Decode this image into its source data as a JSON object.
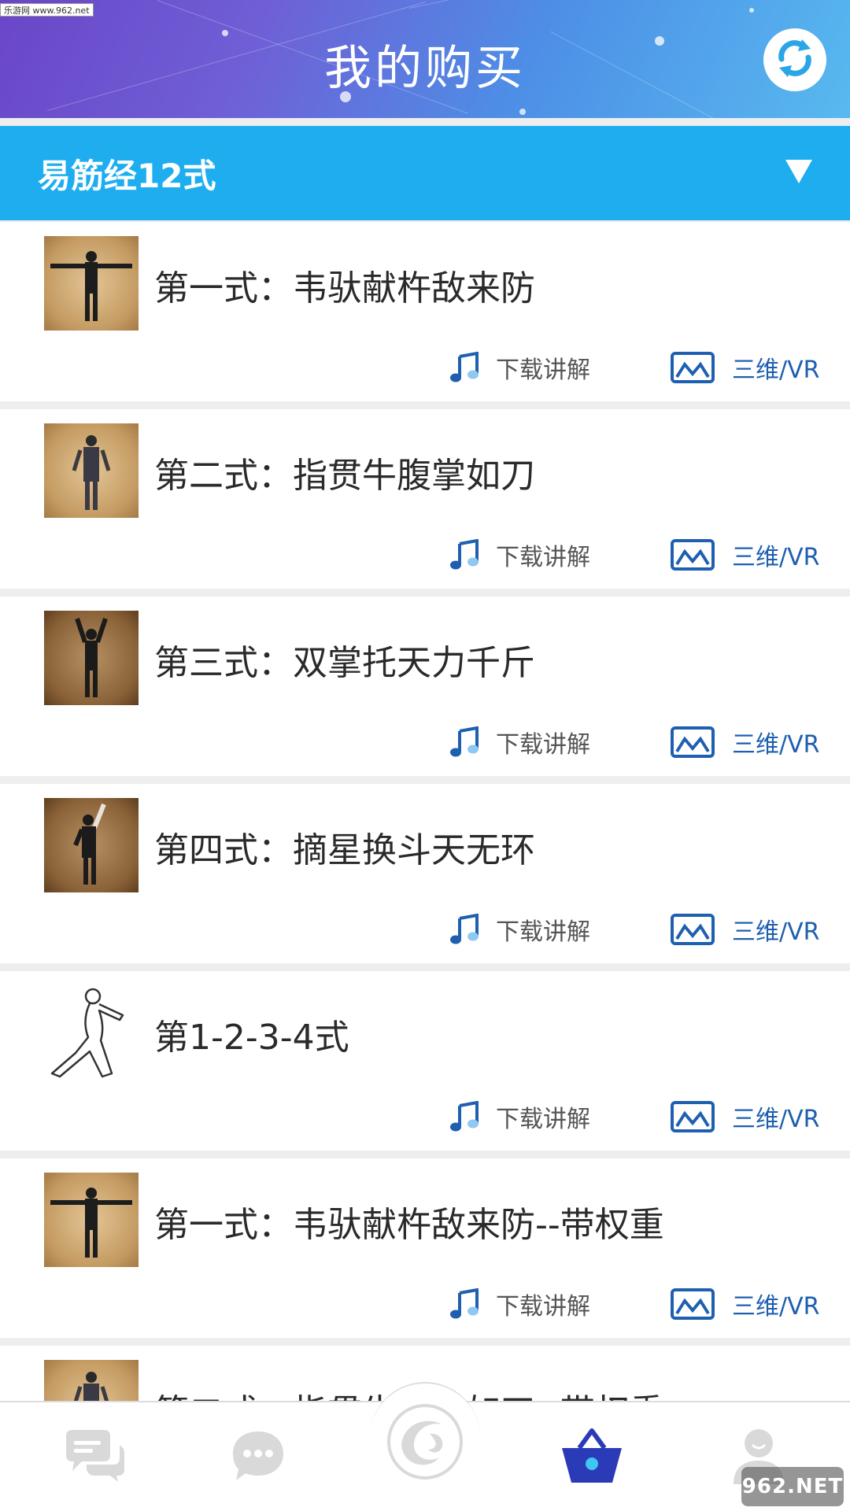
{
  "header": {
    "title": "我的购买",
    "refresh_icon": "refresh-icon"
  },
  "watermarks": {
    "top_left": "乐游网 www.962.net",
    "bottom_right": "962.NET"
  },
  "section": {
    "title": "易筋经12式",
    "toggle_icon": "triangle-down-icon"
  },
  "actions": {
    "audio_label": "下载讲解",
    "vr_label": "三维/VR"
  },
  "items": [
    {
      "title": "第一式：韦驮献杵敌来防",
      "thumb": "figure-arms-out"
    },
    {
      "title": "第二式：指贯牛腹掌如刀",
      "thumb": "figure-hands-down"
    },
    {
      "title": "第三式：双掌托天力千斤",
      "thumb": "figure-arms-up"
    },
    {
      "title": "第四式：摘星换斗天无环",
      "thumb": "figure-one-arm-up"
    },
    {
      "title": "第1-2-3-4式",
      "thumb": "figure-outline"
    },
    {
      "title": "第一式：韦驮献杵敌来防--带权重",
      "thumb": "figure-arms-out"
    },
    {
      "title": "第二式：指贯牛腹掌如刀--带权重",
      "thumb": "figure-hands-down"
    }
  ],
  "nav": {
    "items": [
      "chat-bubbles-icon",
      "message-icon",
      "logo-swirl-icon",
      "basket-icon",
      "profile-icon"
    ],
    "active_index": 3,
    "active_color": "#2b3bb8",
    "inactive_color": "#d9d9d9"
  },
  "colors": {
    "section_bar": "#1eaef0",
    "vr_text": "#1e5fb0"
  }
}
